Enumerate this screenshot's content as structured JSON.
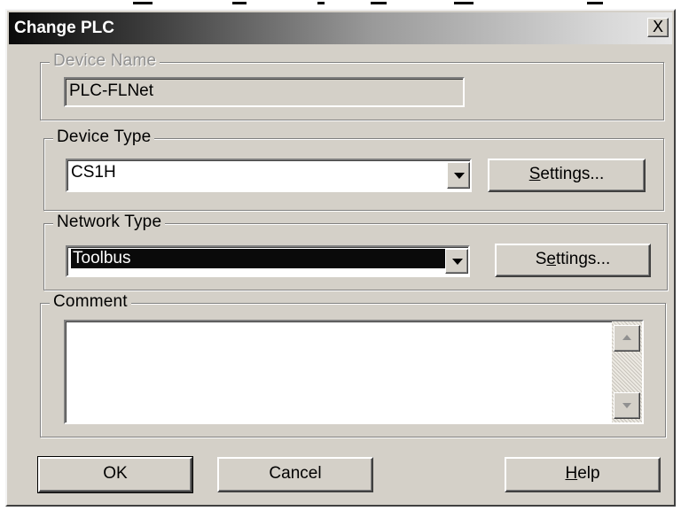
{
  "window": {
    "title": "Change PLC",
    "close_glyph": "X"
  },
  "device_name": {
    "legend": "Device Name",
    "value": "PLC-FLNet"
  },
  "device_type": {
    "legend": "Device Type",
    "value": "CS1H",
    "settings_label_accel": "S",
    "settings_label_rest": "ettings..."
  },
  "network_type": {
    "legend": "Network Type",
    "value": "Toolbus",
    "settings_label_pre": "S",
    "settings_label_accel": "e",
    "settings_label_rest": "ttings..."
  },
  "comment": {
    "legend": "Comment",
    "value": ""
  },
  "buttons": {
    "ok_label": "OK",
    "cancel_label": "Cancel",
    "help_label_accel": "H",
    "help_label_rest": "elp"
  },
  "colors": {
    "dialog_face": "#d4d0c8",
    "selection": "#0a0a0a"
  }
}
